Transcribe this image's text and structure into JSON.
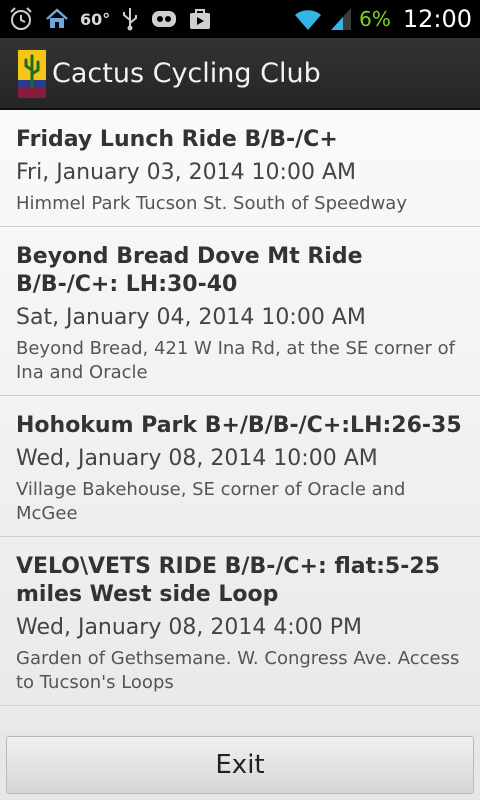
{
  "status_bar": {
    "temperature": "60°",
    "battery_percent": "6%",
    "time": "12:00",
    "icons": [
      "alarm-icon",
      "home-icon",
      "usb-icon",
      "cyanogen-icon",
      "bag-icon",
      "wifi-icon",
      "signal-icon"
    ]
  },
  "action_bar": {
    "title": "Cactus Cycling Club",
    "icon": "cactus-logo-icon"
  },
  "rides": [
    {
      "title": "Friday Lunch Ride B/B-/C+",
      "date": "Fri, January 03, 2014 10:00 AM",
      "location": "Himmel Park Tucson St. South of Speedway"
    },
    {
      "title": "Beyond Bread Dove Mt Ride B/B-/C+: LH:30-40",
      "date": "Sat, January 04, 2014 10:00 AM",
      "location": "Beyond Bread, 421 W Ina Rd, at the SE corner of Ina and Oracle"
    },
    {
      "title": "Hohokum Park B+/B/B-/C+:LH:26-35",
      "date": "Wed, January 08, 2014 10:00 AM",
      "location": "Village Bakehouse, SE corner of Oracle and McGee"
    },
    {
      "title": "VELO\\VETS RIDE  B/B-/C+: flat:5-25 miles West side Loop",
      "date": "Wed, January 08, 2014 4:00 PM",
      "location": "Garden of Gethsemane. W. Congress Ave. Access to Tucson's Loops"
    }
  ],
  "footer": {
    "exit_label": "Exit"
  }
}
